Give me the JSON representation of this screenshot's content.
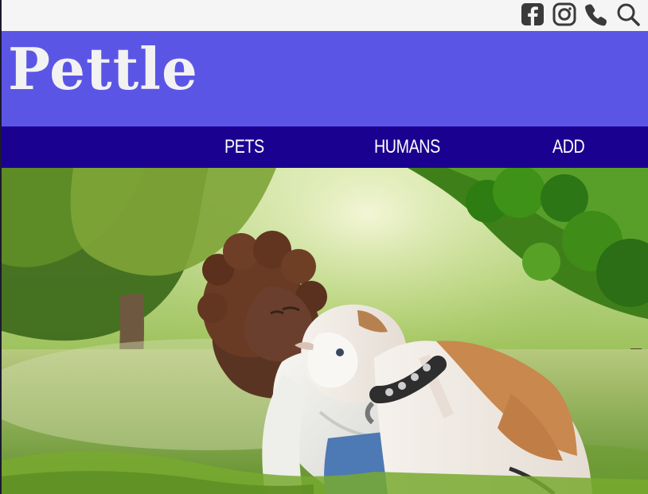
{
  "header": {
    "icons": [
      {
        "name": "facebook-icon",
        "color": "#3a3a3a"
      },
      {
        "name": "instagram-icon",
        "color": "#3a3a3a"
      },
      {
        "name": "phone-icon",
        "color": "#3a3a3a"
      },
      {
        "name": "search-icon",
        "color": "#3a3a3a"
      }
    ]
  },
  "brand": {
    "logo_text": "Pettle",
    "background_color": "#5b55e6",
    "logo_color": "#f2f2f2"
  },
  "nav": {
    "background_color": "#1b018f",
    "items": [
      {
        "label": "PETS"
      },
      {
        "label": "HUMANS"
      },
      {
        "label": "ADD"
      }
    ]
  },
  "hero": {
    "image_subject": "woman kissing bulldog in park"
  }
}
